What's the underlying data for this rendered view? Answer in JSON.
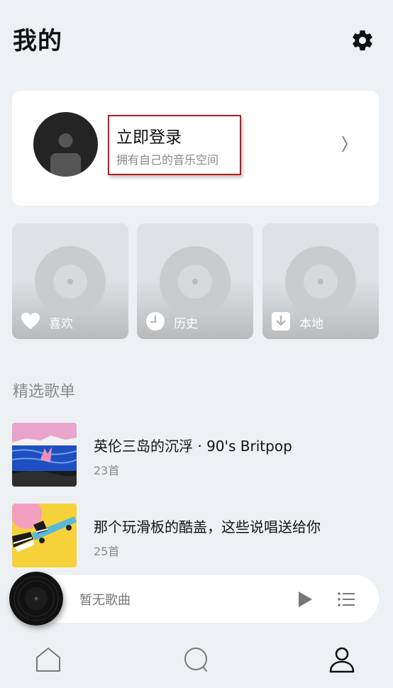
{
  "header": {
    "title": "我的"
  },
  "profile": {
    "login_title": "立即登录",
    "login_subtitle": "拥有自己的音乐空间"
  },
  "quick_access": [
    {
      "label": "喜欢",
      "icon": "heart-icon"
    },
    {
      "label": "历史",
      "icon": "clock-icon"
    },
    {
      "label": "本地",
      "icon": "download-icon"
    }
  ],
  "section": {
    "title": "精选歌单"
  },
  "playlists": [
    {
      "name": "英伦三岛的沉浮 · 90's Britpop",
      "count": "23首"
    },
    {
      "name": "那个玩滑板的酷盖，这些说唱送给你",
      "count": "25首"
    }
  ],
  "player": {
    "song": "暂无歌曲"
  },
  "tabbar": {
    "icons": [
      "home-icon",
      "search-icon",
      "profile-icon"
    ],
    "active": "profile-icon"
  },
  "colors": {
    "background": "#eef1f3",
    "highlight_border": "#b21e1e",
    "secondary_text": "#8a8a8a"
  }
}
